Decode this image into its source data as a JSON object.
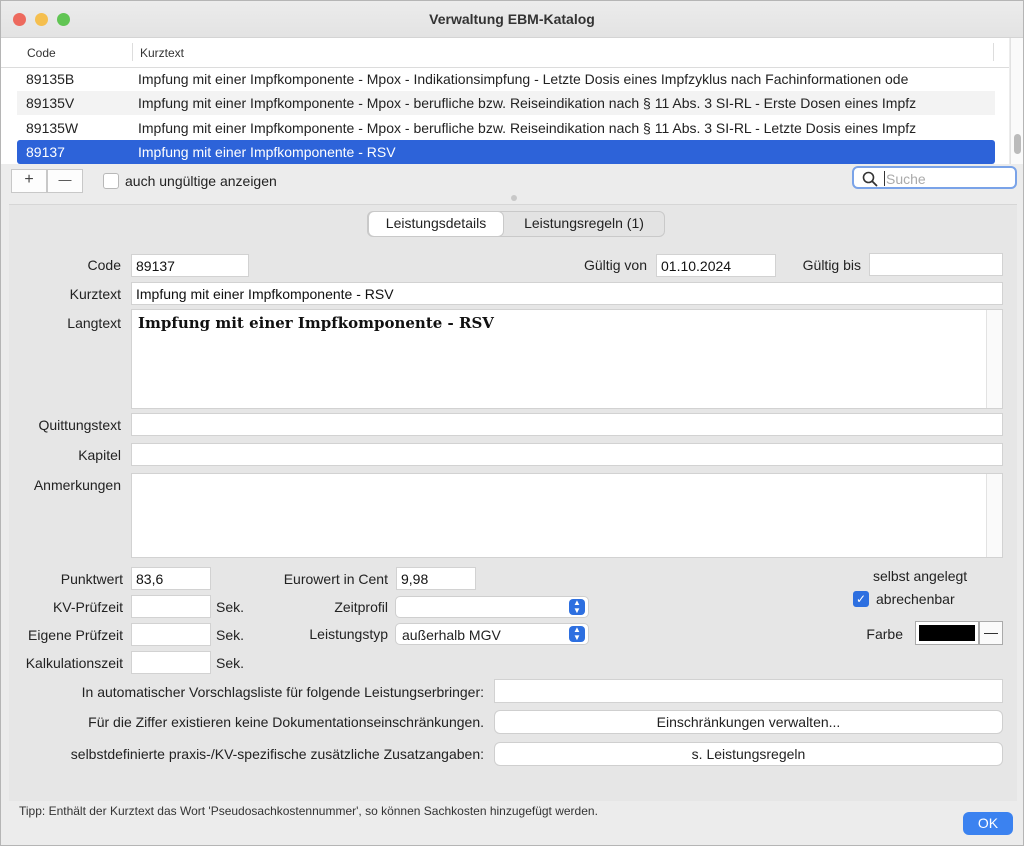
{
  "window": {
    "title": "Verwaltung EBM-Katalog"
  },
  "table": {
    "headers": {
      "code": "Code",
      "kurztext": "Kurztext"
    },
    "rows": [
      {
        "code": "89135B",
        "text": "Impfung mit einer Impfkomponente - Mpox - Indikationsimpfung - Letzte Dosis eines Impfzyklus nach Fachinformationen ode"
      },
      {
        "code": "89135V",
        "text": "Impfung mit einer Impfkomponente - Mpox - berufliche bzw. Reiseindikation nach § 11 Abs. 3 SI-RL - Erste Dosen eines Impfz"
      },
      {
        "code": "89135W",
        "text": "Impfung mit einer Impfkomponente - Mpox - berufliche bzw. Reiseindikation nach § 11 Abs. 3 SI-RL - Letzte Dosis eines Impfz"
      },
      {
        "code": "89137",
        "text": "Impfung mit einer Impfkomponente - RSV"
      }
    ]
  },
  "toolbar": {
    "add_label": "+",
    "remove_label": "—",
    "show_invalid_label": "auch ungültige anzeigen",
    "search_placeholder": "Suche"
  },
  "tabs": [
    {
      "label": "Leistungsdetails",
      "active": true
    },
    {
      "label": "Leistungsregeln (1)",
      "active": false
    }
  ],
  "details": {
    "code_label": "Code",
    "code_value": "89137",
    "valid_from_label": "Gültig von",
    "valid_from_value": "01.10.2024",
    "valid_to_label": "Gültig bis",
    "valid_to_value": "",
    "kurztext_label": "Kurztext",
    "kurztext_value": "Impfung mit einer Impfkomponente - RSV",
    "langtext_label": "Langtext",
    "langtext_value": "Impfung mit einer Impfkomponente - RSV",
    "quittung_label": "Quittungstext",
    "quittung_value": "",
    "kapitel_label": "Kapitel",
    "kapitel_value": "",
    "anmerkungen_label": "Anmerkungen",
    "anmerkungen_value": "",
    "punktwert_label": "Punktwert",
    "punktwert_value": "83,6",
    "eurowert_label": "Eurowert in Cent",
    "eurowert_value": "9,98",
    "selbst_angelegt_label": "selbst angelegt",
    "abrechenbar_label": "abrechenbar",
    "kv_pruefzeit_label": "KV-Prüfzeit",
    "kv_pruefzeit_value": "",
    "eigene_pruefzeit_label": "Eigene Prüfzeit",
    "eigene_pruefzeit_value": "",
    "kalkulationszeit_label": "Kalkulationszeit",
    "kalkulationszeit_value": "",
    "sek_label": "Sek.",
    "zeitprofil_label": "Zeitprofil",
    "zeitprofil_value": "",
    "leistungstyp_label": "Leistungstyp",
    "leistungstyp_value": "außerhalb MGV",
    "farbe_label": "Farbe",
    "farbe_color": "#000000",
    "vorschlag_label": "In automatischer Vorschlagsliste für folgende Leistungserbringer:",
    "vorschlag_value": "",
    "doku_label": "Für die Ziffer existieren keine Dokumentationseinschränkungen.",
    "doku_button": "Einschränkungen verwalten...",
    "zusatz_label": "selbstdefinierte praxis-/KV-spezifische zusätzliche Zusatzangaben:",
    "zusatz_button": "s. Leistungsregeln"
  },
  "footer": {
    "tip": "Tipp: Enthält der Kurztext das Wort 'Pseudosachkostennummer', so können Sachkosten hinzugefügt werden.",
    "ok_label": "OK"
  },
  "colors": {
    "accent": "#2d63d9",
    "close": "#ed6a5e",
    "minimize": "#f5bf4f",
    "zoom": "#61c554"
  }
}
